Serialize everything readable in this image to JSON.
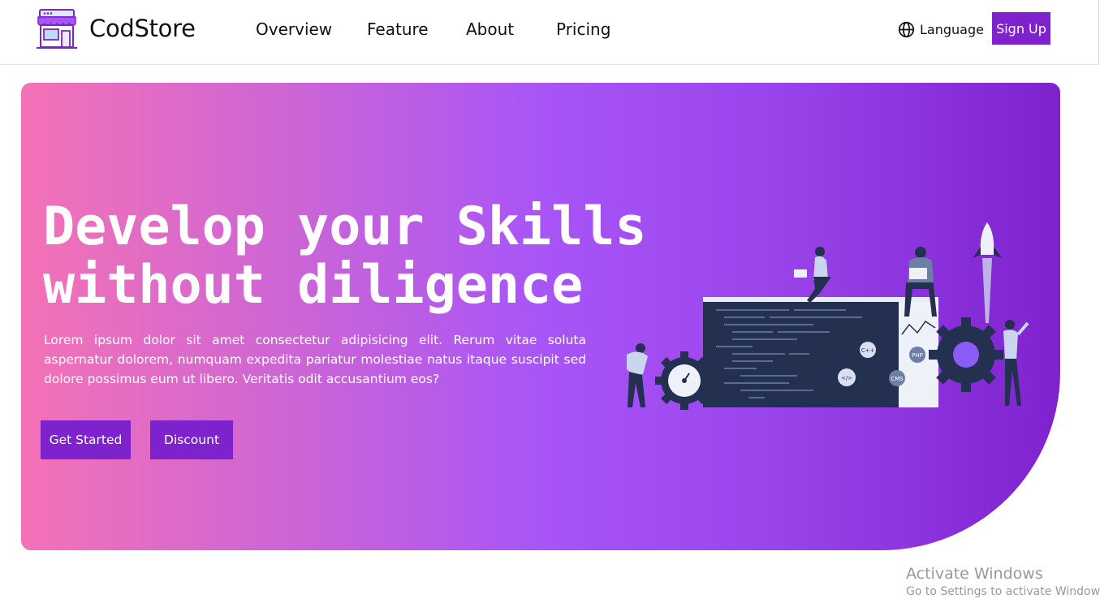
{
  "header": {
    "brand": "CodStore",
    "logo_icon": "storefront-icon",
    "nav": [
      "Overview",
      "Feature",
      "About",
      "Pricing"
    ],
    "language_icon": "globe-icon",
    "language_label": "Language",
    "signup_label": "Sign Up"
  },
  "hero": {
    "headline_line1": "Develop your Skills",
    "headline_line2": "without diligence",
    "description": "Lorem ipsum dolor sit amet consectetur adipisicing elit. Rerum vitae soluta aspernatur dolorem, numquam expedita pariatur molestiae natus itaque suscipit sed dolore possimus eum ut libero. Veritatis odit accusantium eos?",
    "buttons": [
      "Get Started",
      "Discount"
    ],
    "illustration_labels": [
      "C++",
      "PHP",
      "</>",
      "CMS"
    ]
  },
  "watermark": {
    "title": "Activate Windows",
    "subtitle": "Go to Settings to activate Windows."
  },
  "colors": {
    "accent": "#7e22ce",
    "gradient_start": "#f472b6",
    "gradient_mid": "#a855f7",
    "gradient_end": "#7e22ce",
    "screen_dark": "#24304f"
  }
}
